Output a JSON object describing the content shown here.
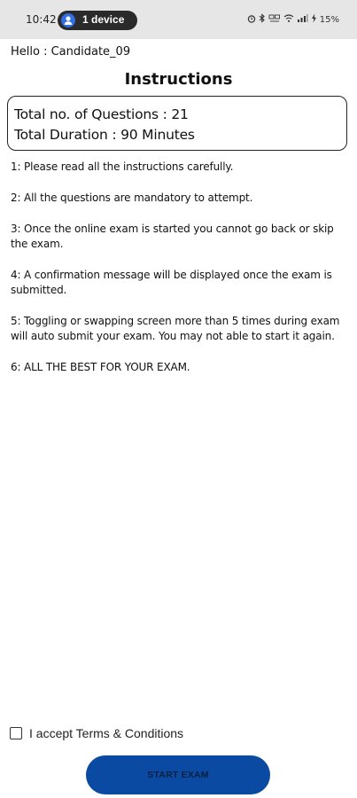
{
  "status_bar": {
    "time": "10:42",
    "device_pill_label": "1 device",
    "battery": "15%"
  },
  "header": {
    "greeting": "Hello : Candidate_09",
    "title": "Instructions"
  },
  "summary": {
    "questions": "Total no. of Questions : 21",
    "duration": "Total Duration : 90 Minutes"
  },
  "instructions": [
    "1: Please read all the instructions carefully.",
    "2: All the questions are mandatory to attempt.",
    "3: Once the online exam is started you cannot go back or skip the exam.",
    "4: A confirmation message will be displayed once the exam is submitted.",
    "5: Toggling or swapping screen more than 5 times during exam will auto submit your exam. You may not able to start it again.",
    "6: ALL THE BEST FOR YOUR EXAM."
  ],
  "terms": {
    "label": "I accept Terms & Conditions",
    "checked": false
  },
  "actions": {
    "start_label": "START EXAM"
  },
  "colors": {
    "button_bg": "#0a4aa3",
    "button_text": "#0b1f3f",
    "status_bar_bg": "#e6e6e6",
    "pill_bg": "#2a2a2a",
    "pill_icon": "#2f6fe4"
  },
  "icons": {
    "pill_icon": "person-icon",
    "status_icons": [
      "alarm-icon",
      "bluetooth-icon",
      "data-icon",
      "wifi-icon",
      "signal-icon",
      "charging-icon"
    ]
  }
}
